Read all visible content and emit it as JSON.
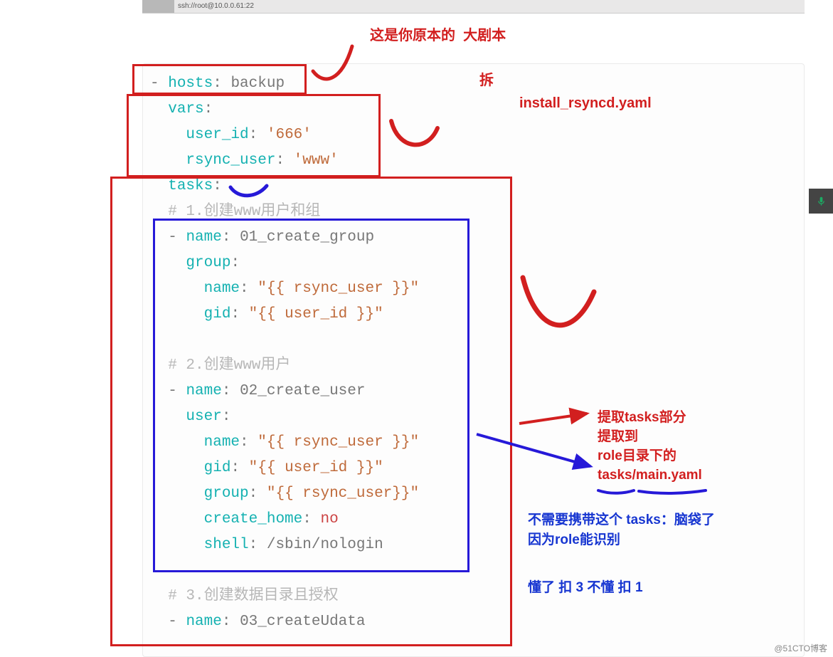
{
  "ssh_text": "ssh://root@10.0.0.61:22",
  "top_label_1": "这是你原本的",
  "top_label_2": "大剧本",
  "top_label_3": "拆",
  "filename": "install_rsyncd.yaml",
  "ann1": "提取tasks部分",
  "ann2": "提取到",
  "ann3": "role目录下的",
  "ann4": "tasks/main.yaml",
  "ann5": "不需要携带这个 tasks：脑袋了",
  "ann6": "因为role能识别",
  "ann7": "懂了 扣 3  不懂 扣 1",
  "watermark": "@51CTO博客",
  "code": {
    "l1a": "- ",
    "l1k": "hosts",
    "l1b": ": backup",
    "l2k": "vars",
    "l2b": ":",
    "l3k": "user_id",
    "l3b": ": ",
    "l3s": "'666'",
    "l4k": "rsync_user",
    "l4b": ": ",
    "l4s": "'www'",
    "l5k": "tasks",
    "l5b": ":",
    "l6c": "# 1.创建www用户和组",
    "l7a": "- ",
    "l7k": "name",
    "l7b": ": 01_create_group",
    "l8k": "group",
    "l8b": ":",
    "l9k": "name",
    "l9b": ": ",
    "l9s": "\"{{ rsync_user }}\"",
    "l10k": "gid",
    "l10b": ": ",
    "l10s": "\"{{ user_id }}\"",
    "l12c": "# 2.创建www用户",
    "l13a": "- ",
    "l13k": "name",
    "l13b": ": 02_create_user",
    "l14k": "user",
    "l14b": ":",
    "l15k": "name",
    "l15b": ": ",
    "l15s": "\"{{ rsync_user }}\"",
    "l16k": "gid",
    "l16b": ": ",
    "l16s": "\"{{ user_id }}\"",
    "l17k": "group",
    "l17b": ": ",
    "l17s": "\"{{ rsync_user}}\"",
    "l18k": "create_home",
    "l18b": ": ",
    "l18n": "no",
    "l19k": "shell",
    "l19b": ": /sbin/nologin",
    "l21c": "# 3.创建数据目录且授权",
    "l22a": "- ",
    "l22k": "name",
    "l22b": ": 03_createUdata"
  }
}
